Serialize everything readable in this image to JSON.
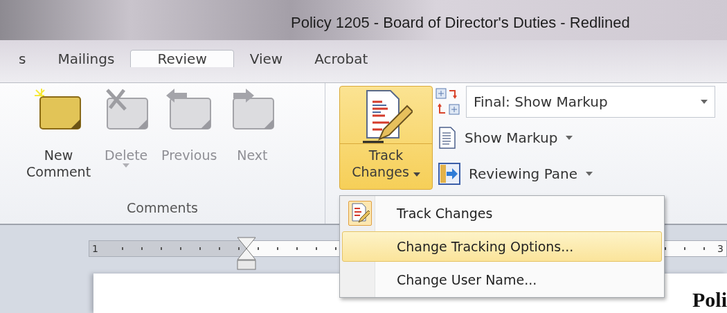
{
  "window": {
    "title": "Policy 1205 - Board of Director's Duties - Redlined"
  },
  "tabs": [
    {
      "label": "s",
      "selected": false
    },
    {
      "label": "Mailings",
      "selected": false
    },
    {
      "label": "Review",
      "selected": true
    },
    {
      "label": "View",
      "selected": false
    },
    {
      "label": "Acrobat",
      "selected": false
    }
  ],
  "ribbon": {
    "comments_group": {
      "label": "Comments",
      "buttons": [
        {
          "kind": "new",
          "label": "New Comment",
          "disabled": false,
          "dropdown": false
        },
        {
          "kind": "delete",
          "label": "Delete",
          "disabled": true,
          "dropdown": true
        },
        {
          "kind": "previous",
          "label": "Previous",
          "disabled": true,
          "dropdown": false
        },
        {
          "kind": "next",
          "label": "Next",
          "disabled": true,
          "dropdown": false
        }
      ]
    },
    "tracking_group": {
      "track_changes": {
        "label": "Track Changes",
        "pressed": true
      },
      "display_dropdown": {
        "value": "Final: Show Markup"
      },
      "buttons": [
        {
          "kind": "show-markup",
          "label": "Show Markup"
        },
        {
          "kind": "reviewing-pane",
          "label": "Reviewing Pane"
        }
      ]
    }
  },
  "ruler": {
    "labels": [
      "1",
      "3"
    ]
  },
  "menu": {
    "items": [
      {
        "kind": "toggle",
        "label": "Track Changes",
        "checked": true,
        "selected": false
      },
      {
        "kind": "command",
        "label": "Change Tracking Options...",
        "checked": false,
        "selected": true
      },
      {
        "kind": "command",
        "label": "Change User Name...",
        "checked": false,
        "selected": false
      }
    ]
  },
  "document": {
    "text": "Poli"
  }
}
